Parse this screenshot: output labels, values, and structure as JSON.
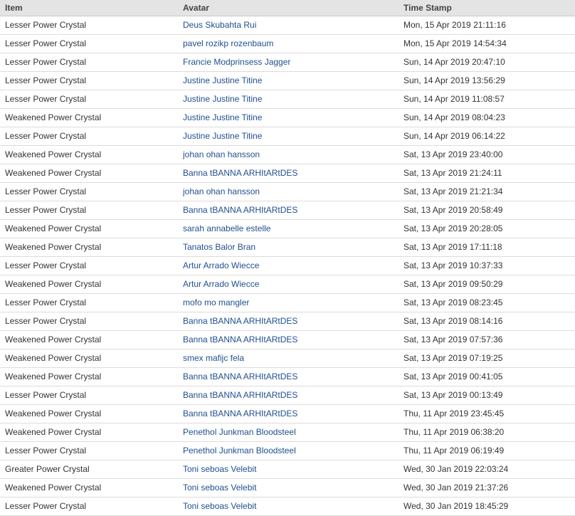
{
  "table": {
    "headers": {
      "item": "Item",
      "avatar": "Avatar",
      "time": "Time Stamp"
    },
    "rows": [
      {
        "item": "Lesser Power Crystal",
        "avatar": "Deus Skubahta Rui",
        "time": "Mon, 15 Apr 2019 21:11:16"
      },
      {
        "item": "Lesser Power Crystal",
        "avatar": "pavel rozikp rozenbaum",
        "time": "Mon, 15 Apr 2019 14:54:34"
      },
      {
        "item": "Lesser Power Crystal",
        "avatar": "Francie Modprinsess Jagger",
        "time": "Sun, 14 Apr 2019 20:47:10"
      },
      {
        "item": "Lesser Power Crystal",
        "avatar": "Justine Justine Titine",
        "time": "Sun, 14 Apr 2019 13:56:29"
      },
      {
        "item": "Lesser Power Crystal",
        "avatar": "Justine Justine Titine",
        "time": "Sun, 14 Apr 2019 11:08:57"
      },
      {
        "item": "Weakened Power Crystal",
        "avatar": "Justine Justine Titine",
        "time": "Sun, 14 Apr 2019 08:04:23"
      },
      {
        "item": "Lesser Power Crystal",
        "avatar": "Justine Justine Titine",
        "time": "Sun, 14 Apr 2019 06:14:22"
      },
      {
        "item": "Weakened Power Crystal",
        "avatar": "johan ohan hansson",
        "time": "Sat, 13 Apr 2019 23:40:00"
      },
      {
        "item": "Weakened Power Crystal",
        "avatar": "Banna tBANNA ARHItARtDES",
        "time": "Sat, 13 Apr 2019 21:24:11"
      },
      {
        "item": "Lesser Power Crystal",
        "avatar": "johan ohan hansson",
        "time": "Sat, 13 Apr 2019 21:21:34"
      },
      {
        "item": "Lesser Power Crystal",
        "avatar": "Banna tBANNA ARHItARtDES",
        "time": "Sat, 13 Apr 2019 20:58:49"
      },
      {
        "item": "Weakened Power Crystal",
        "avatar": "sarah annabelle estelle",
        "time": "Sat, 13 Apr 2019 20:28:05"
      },
      {
        "item": "Weakened Power Crystal",
        "avatar": "Tanatos Balor Bran",
        "time": "Sat, 13 Apr 2019 17:11:18"
      },
      {
        "item": "Lesser Power Crystal",
        "avatar": "Artur Arrado Wiecce",
        "time": "Sat, 13 Apr 2019 10:37:33"
      },
      {
        "item": "Weakened Power Crystal",
        "avatar": "Artur Arrado Wiecce",
        "time": "Sat, 13 Apr 2019 09:50:29"
      },
      {
        "item": "Lesser Power Crystal",
        "avatar": "mofo mo mangler",
        "time": "Sat, 13 Apr 2019 08:23:45"
      },
      {
        "item": "Lesser Power Crystal",
        "avatar": "Banna tBANNA ARHItARtDES",
        "time": "Sat, 13 Apr 2019 08:14:16"
      },
      {
        "item": "Weakened Power Crystal",
        "avatar": "Banna tBANNA ARHItARtDES",
        "time": "Sat, 13 Apr 2019 07:57:36"
      },
      {
        "item": "Weakened Power Crystal",
        "avatar": "smex mafijc fela",
        "time": "Sat, 13 Apr 2019 07:19:25"
      },
      {
        "item": "Weakened Power Crystal",
        "avatar": "Banna tBANNA ARHItARtDES",
        "time": "Sat, 13 Apr 2019 00:41:05"
      },
      {
        "item": "Lesser Power Crystal",
        "avatar": "Banna tBANNA ARHItARtDES",
        "time": "Sat, 13 Apr 2019 00:13:49"
      },
      {
        "item": "Weakened Power Crystal",
        "avatar": "Banna tBANNA ARHItARtDES",
        "time": "Thu, 11 Apr 2019 23:45:45"
      },
      {
        "item": "Weakened Power Crystal",
        "avatar": "Penethol Junkman Bloodsteel",
        "time": "Thu, 11 Apr 2019 06:38:20"
      },
      {
        "item": "Lesser Power Crystal",
        "avatar": "Penethol Junkman Bloodsteel",
        "time": "Thu, 11 Apr 2019 06:19:49"
      },
      {
        "item": "Greater Power Crystal",
        "avatar": "Toni seboas Velebit",
        "time": "Wed, 30 Jan 2019 22:03:24"
      },
      {
        "item": "Weakened Power Crystal",
        "avatar": "Toni seboas Velebit",
        "time": "Wed, 30 Jan 2019 21:37:26"
      },
      {
        "item": "Lesser Power Crystal",
        "avatar": "Toni seboas Velebit",
        "time": "Wed, 30 Jan 2019 18:45:29"
      }
    ]
  }
}
